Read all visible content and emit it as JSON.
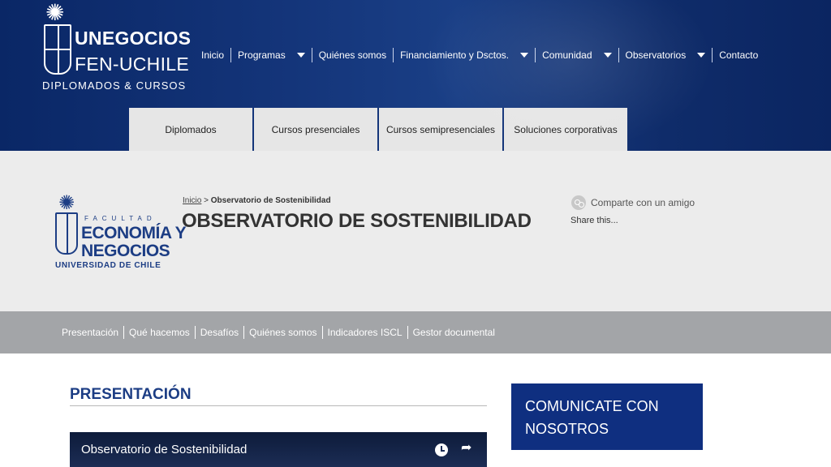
{
  "header": {
    "logo": {
      "line1": "UNEGOCIOS",
      "line2": "FEN-UCHILE",
      "line3": "DIPLOMADOS & CURSOS"
    },
    "nav": [
      {
        "label": "Inicio",
        "dropdown": false
      },
      {
        "label": "Programas",
        "dropdown": true
      },
      {
        "label": "Quiénes somos",
        "dropdown": false
      },
      {
        "label": "Financiamiento y Dsctos.",
        "dropdown": true
      },
      {
        "label": "Comunidad",
        "dropdown": true
      },
      {
        "label": "Observatorios",
        "dropdown": true
      },
      {
        "label": "Contacto",
        "dropdown": false
      }
    ],
    "tabs": [
      "Diplomados",
      "Cursos presenciales",
      "Cursos semipresenciales",
      "Soluciones corporativas"
    ]
  },
  "fen_logo": {
    "facultad": "FACULTAD",
    "line1": "ECONOMÍA Y",
    "line2": "NEGOCIOS",
    "line3": "UNIVERSIDAD DE CHILE"
  },
  "breadcrumb": {
    "home": "Inicio",
    "separator": ">",
    "current": "Observatorio de Sostenibilidad"
  },
  "page_title": "OBSERVATORIO DE SOSTENIBILIDAD",
  "share": {
    "label": "Comparte con un amigo",
    "sub": "Share this..."
  },
  "secondary_nav": [
    "Presentación",
    "Qué hacemos",
    "Desafíos",
    "Quiénes somos",
    "Indicadores ISCL",
    "Gestor documental"
  ],
  "content": {
    "section_title": "PRESENTACIÓN",
    "video_title": "Observatorio de Sostenibilidad"
  },
  "contact": {
    "line1": "COMUNICATE CON",
    "line2": "NOSOTROS"
  },
  "colors": {
    "header_bg": "#14357a",
    "brand_blue": "#1c3d84",
    "contact_bg": "#0f2f80",
    "secondary_nav_bg": "#a3a5a8",
    "band_bg": "#ececec"
  },
  "icons": [
    "star-emblem-icon",
    "crest-icon",
    "chevron-down-icon",
    "share-icon",
    "clock-icon",
    "share-arrow-icon"
  ]
}
